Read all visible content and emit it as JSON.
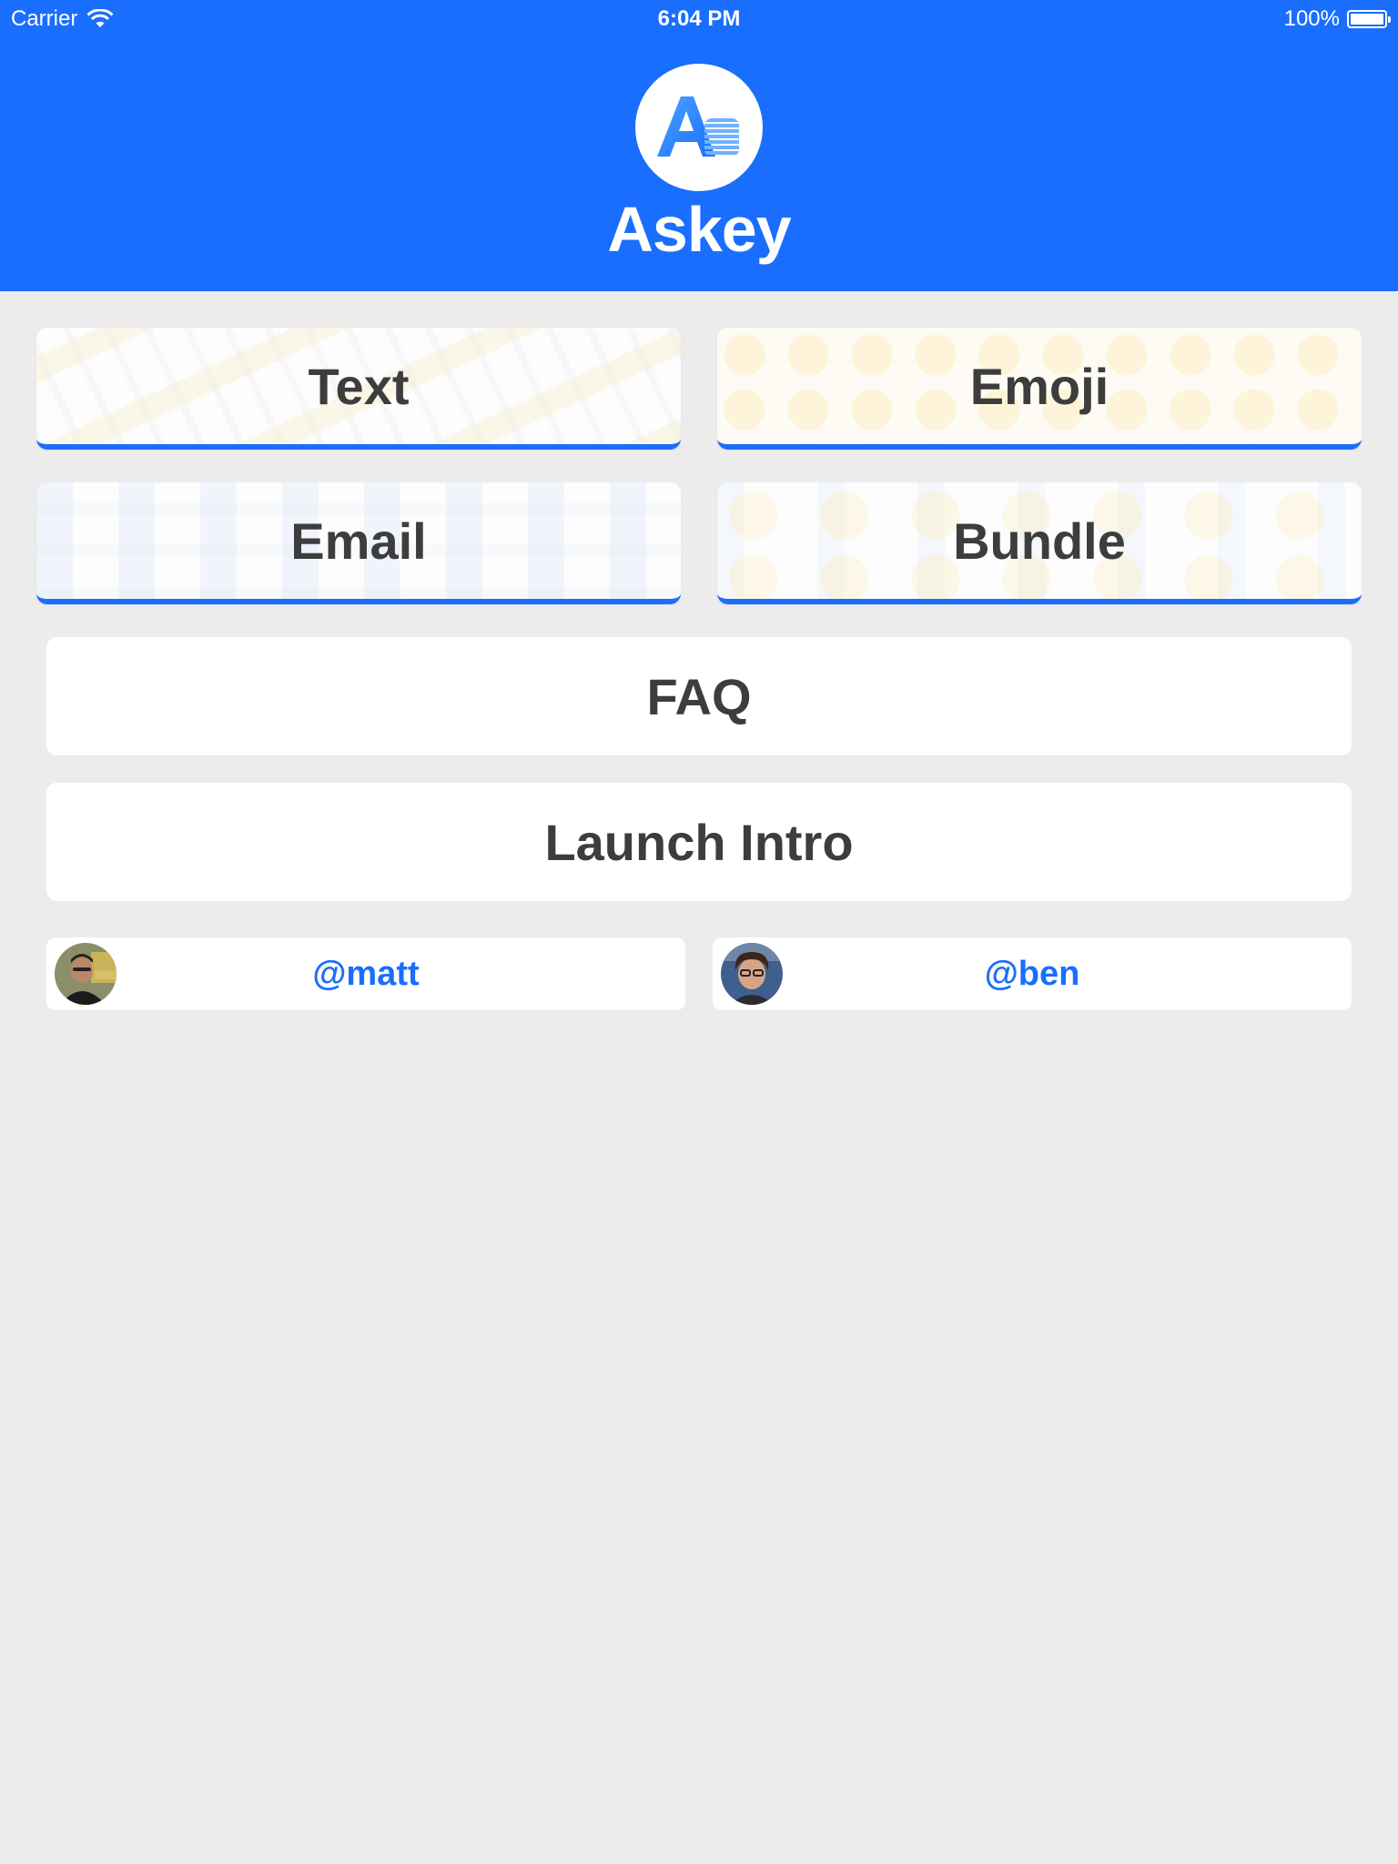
{
  "status_bar": {
    "carrier": "Carrier",
    "time": "6:04 PM",
    "battery": "100%"
  },
  "header": {
    "title": "Askey",
    "logo_letters": "Aa"
  },
  "colors": {
    "brand": "#1a6efe",
    "background": "#ececec",
    "button_text": "#3d3d3d"
  },
  "categories": [
    {
      "label": "Text"
    },
    {
      "label": "Emoji"
    },
    {
      "label": "Email"
    },
    {
      "label": "Bundle"
    }
  ],
  "buttons": {
    "faq": "FAQ",
    "launch_intro": "Launch Intro"
  },
  "authors": [
    {
      "handle": "@matt"
    },
    {
      "handle": "@ben"
    }
  ]
}
